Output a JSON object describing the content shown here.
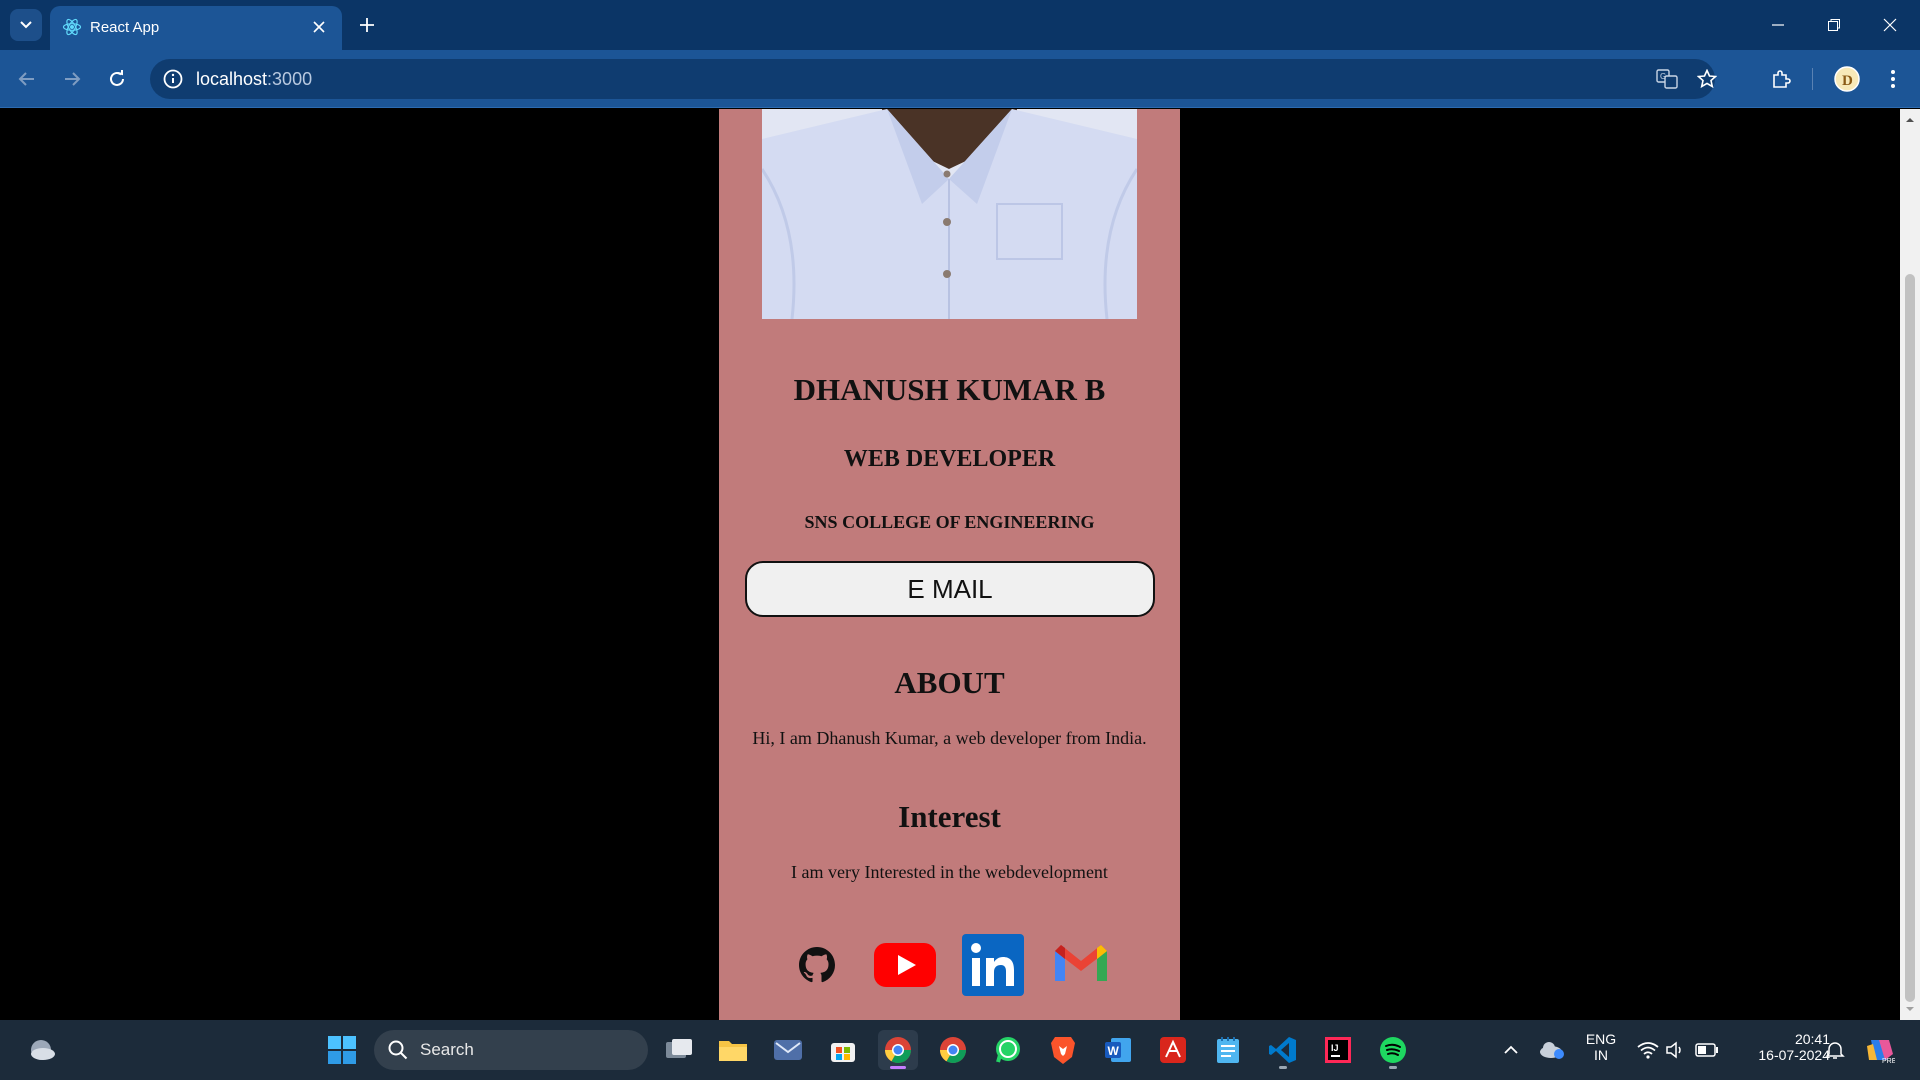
{
  "browser": {
    "tab_title": "React App",
    "url_host": "localhost",
    "url_port": ":3000"
  },
  "profile": {
    "name": "DHANUSH KUMAR B",
    "role": "WEB DEVELOPER",
    "college": "SNS COLLEGE OF ENGINEERING",
    "email_button": "E MAIL",
    "about_heading": "ABOUT",
    "about_text": "Hi, I am Dhanush Kumar, a web developer from India.",
    "interest_heading": "Interest",
    "interest_text": "I am very Interested in the webdevelopment",
    "socials": [
      "github-icon",
      "youtube-icon",
      "linkedin-icon",
      "gmail-icon"
    ]
  },
  "taskbar": {
    "search_label": "Search",
    "lang_top": "ENG",
    "lang_bottom": "IN",
    "time": "20:41",
    "date": "16-07-2024"
  },
  "colors": {
    "card_bg": "#c17b7b",
    "chrome_titlebar": "#0b3566",
    "chrome_toolbar": "#1c5596"
  }
}
